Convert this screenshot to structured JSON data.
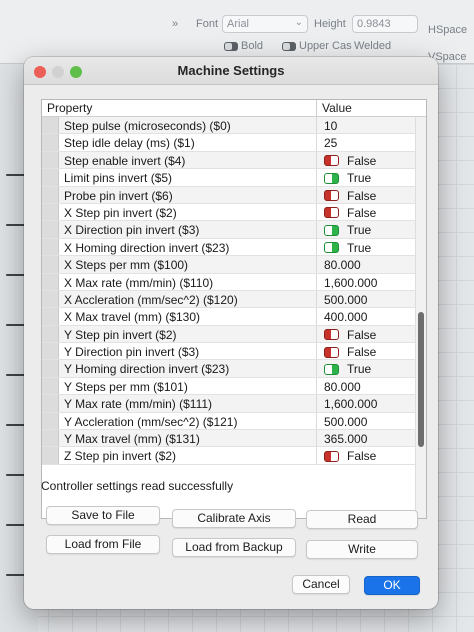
{
  "toolbar": {
    "chevron": "»",
    "font_label": "Font",
    "font_value": "Arial",
    "height_label": "Height",
    "height_value": "0.9843",
    "hspace_label": "HSpace",
    "vspace_label": "VSpace",
    "bold_label": "Bold",
    "upper_label": "Upper Cas",
    "welded_label": "Welded"
  },
  "dialog": {
    "title": "Machine Settings",
    "table": {
      "headers": {
        "property": "Property",
        "value": "Value"
      },
      "rows": [
        {
          "property": "Step pulse (microseconds) ($0)",
          "value": "10",
          "toggle": null
        },
        {
          "property": "Step idle delay (ms) ($1)",
          "value": "25",
          "toggle": null
        },
        {
          "property": "Step enable invert ($4)",
          "value": "False",
          "toggle": "off"
        },
        {
          "property": "Limit pins invert ($5)",
          "value": "True",
          "toggle": "on"
        },
        {
          "property": "Probe pin invert ($6)",
          "value": "False",
          "toggle": "off"
        },
        {
          "property": "X Step pin invert ($2)",
          "value": "False",
          "toggle": "off"
        },
        {
          "property": "X Direction pin invert ($3)",
          "value": "True",
          "toggle": "on"
        },
        {
          "property": "X Homing direction invert ($23)",
          "value": "True",
          "toggle": "on"
        },
        {
          "property": "X Steps per mm ($100)",
          "value": "80.000",
          "toggle": null
        },
        {
          "property": "X Max rate (mm/min) ($110)",
          "value": "1,600.000",
          "toggle": null
        },
        {
          "property": "X Accleration (mm/sec^2) ($120)",
          "value": "500.000",
          "toggle": null
        },
        {
          "property": "X Max travel (mm) ($130)",
          "value": "400.000",
          "toggle": null
        },
        {
          "property": "Y Step pin invert ($2)",
          "value": "False",
          "toggle": "off"
        },
        {
          "property": "Y Direction pin invert ($3)",
          "value": "False",
          "toggle": "off"
        },
        {
          "property": "Y Homing direction invert ($23)",
          "value": "True",
          "toggle": "on"
        },
        {
          "property": "Y Steps per mm ($101)",
          "value": "80.000",
          "toggle": null
        },
        {
          "property": "Y Max rate (mm/min) ($111)",
          "value": "1,600.000",
          "toggle": null
        },
        {
          "property": "Y Accleration (mm/sec^2) ($121)",
          "value": "500.000",
          "toggle": null
        },
        {
          "property": "Y Max travel (mm) ($131)",
          "value": "365.000",
          "toggle": null
        },
        {
          "property": "Z Step pin invert ($2)",
          "value": "False",
          "toggle": "off"
        }
      ]
    },
    "status_text": "Controller settings read successfully",
    "buttons": {
      "save_to_file": "Save to File",
      "calibrate_axis": "Calibrate Axis",
      "read": "Read",
      "load_from_file": "Load from File",
      "load_from_backup": "Load from Backup",
      "write": "Write",
      "cancel": "Cancel",
      "ok": "OK"
    }
  },
  "colors": {
    "toggle_on": "#2db34a",
    "toggle_off": "#c7332b",
    "ok_button": "#1a73e8"
  }
}
